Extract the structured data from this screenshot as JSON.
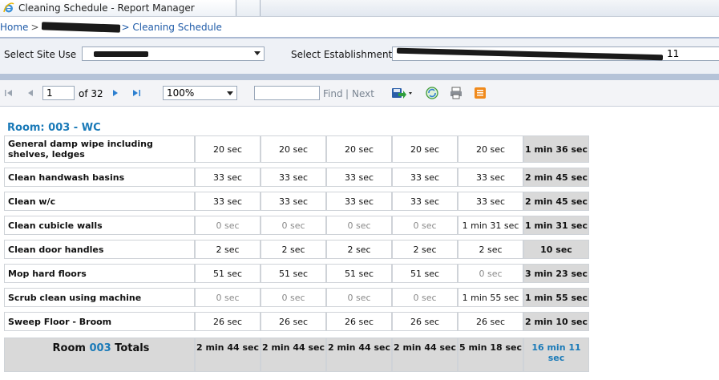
{
  "window": {
    "title": "Cleaning Schedule - Report Manager"
  },
  "breadcrumb": {
    "home": "Home",
    "sep": ">",
    "current": "> Cleaning Schedule"
  },
  "params": {
    "site_label": "Select Site Use",
    "establishment_label": "Select Establishment",
    "establishment_value_tail": "11"
  },
  "toolbar": {
    "page_value": "1",
    "page_of": "of 32",
    "zoom_value": "100%",
    "find_label": "Find",
    "find_sep": "|",
    "next_label": "Next"
  },
  "report": {
    "room_title": "Room: 003 - WC",
    "rows": [
      {
        "task": "General damp wipe including shelves, ledges",
        "values": [
          "20 sec",
          "20 sec",
          "20 sec",
          "20 sec",
          "20 sec"
        ],
        "total": "1 min 36 sec"
      },
      {
        "task": "Clean handwash basins",
        "values": [
          "33 sec",
          "33 sec",
          "33 sec",
          "33 sec",
          "33 sec"
        ],
        "total": "2 min 45 sec"
      },
      {
        "task": "Clean w/c",
        "values": [
          "33 sec",
          "33 sec",
          "33 sec",
          "33 sec",
          "33 sec"
        ],
        "total": "2 min 45 sec"
      },
      {
        "task": "Clean cubicle walls",
        "values": [
          "0 sec",
          "0 sec",
          "0 sec",
          "0 sec",
          "1 min 31 sec"
        ],
        "total": "1 min 31 sec"
      },
      {
        "task": "Clean door handles",
        "values": [
          "2 sec",
          "2 sec",
          "2 sec",
          "2 sec",
          "2 sec"
        ],
        "total": "10 sec"
      },
      {
        "task": "Mop hard floors",
        "values": [
          "51 sec",
          "51 sec",
          "51 sec",
          "51 sec",
          "0 sec"
        ],
        "total": "3 min 23 sec"
      },
      {
        "task": "Scrub clean using machine",
        "values": [
          "0 sec",
          "0 sec",
          "0 sec",
          "0 sec",
          "1 min 55 sec"
        ],
        "total": "1 min 55 sec"
      },
      {
        "task": "Sweep Floor - Broom",
        "values": [
          "26 sec",
          "26 sec",
          "26 sec",
          "26 sec",
          "26 sec"
        ],
        "total": "2 min 10 sec"
      }
    ],
    "totals": {
      "label_prefix": "Room",
      "room_number": "003",
      "label_suffix": "Totals",
      "values": [
        "2 min 44 sec",
        "2 min 44 sec",
        "2 min 44 sec",
        "2 min 44 sec",
        "5 min 18 sec"
      ],
      "grand_total": "16 min 11 sec"
    }
  },
  "colors": {
    "accent": "#1a7ab8",
    "link": "#1f5ba8",
    "total_bg": "#d9d9d9"
  }
}
